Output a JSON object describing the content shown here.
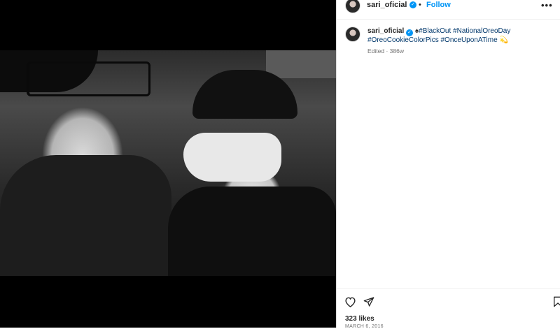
{
  "post": {
    "username": "sari_oficial",
    "follow_label": "Follow",
    "separator": "•",
    "more_label": "•••",
    "caption": {
      "username": "sari_oficial",
      "spade": "♠",
      "tag1": "#BlackOut",
      "tag2": "#NationalOreoDay",
      "tag3": "#OreoCookieColorPics",
      "tag4": "#OnceUponATime",
      "emoji": "💫"
    },
    "edited": "Edited",
    "edited_sep": " · ",
    "age": "386w",
    "likes": "323 likes",
    "date": "MARCH 6, 2016"
  },
  "colors": {
    "accent": "#0095f6",
    "hashtag": "#00376b",
    "muted": "#737373"
  },
  "icons": [
    "heart-icon",
    "share-icon",
    "bookmark-icon",
    "verified-icon",
    "more-icon"
  ]
}
